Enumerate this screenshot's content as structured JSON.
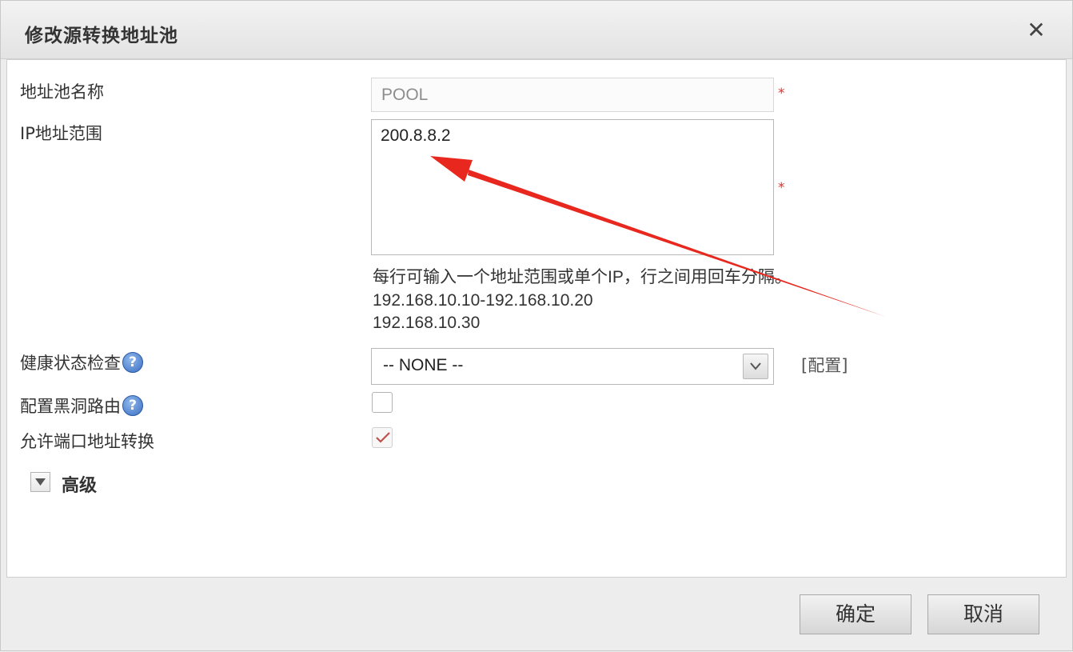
{
  "dialog": {
    "title": "修改源转换地址池",
    "close_symbol": "✕"
  },
  "form": {
    "pool_name": {
      "label": "地址池名称",
      "value": "POOL",
      "required_mark": "*"
    },
    "ip_range": {
      "label": "IP地址范围",
      "value": "200.8.8.2",
      "required_mark": "*",
      "hint_line1": "每行可输入一个地址范围或单个IP，行之间用回车分隔。",
      "hint_line2": "192.168.10.10-192.168.10.20",
      "hint_line3": "192.168.10.30"
    },
    "health_check": {
      "label": "健康状态检查",
      "help": "?",
      "selected": "-- NONE --",
      "config_link": "[配置]"
    },
    "blackhole_route": {
      "label": "配置黑洞路由",
      "help": "?",
      "checked": false
    },
    "port_translation": {
      "label": "允许端口地址转换",
      "checked": true
    },
    "advanced": {
      "label": "高级"
    }
  },
  "footer": {
    "ok_label": "确定",
    "cancel_label": "取消"
  },
  "colors": {
    "annotation_arrow": "#e8281e",
    "required": "#e03232"
  }
}
